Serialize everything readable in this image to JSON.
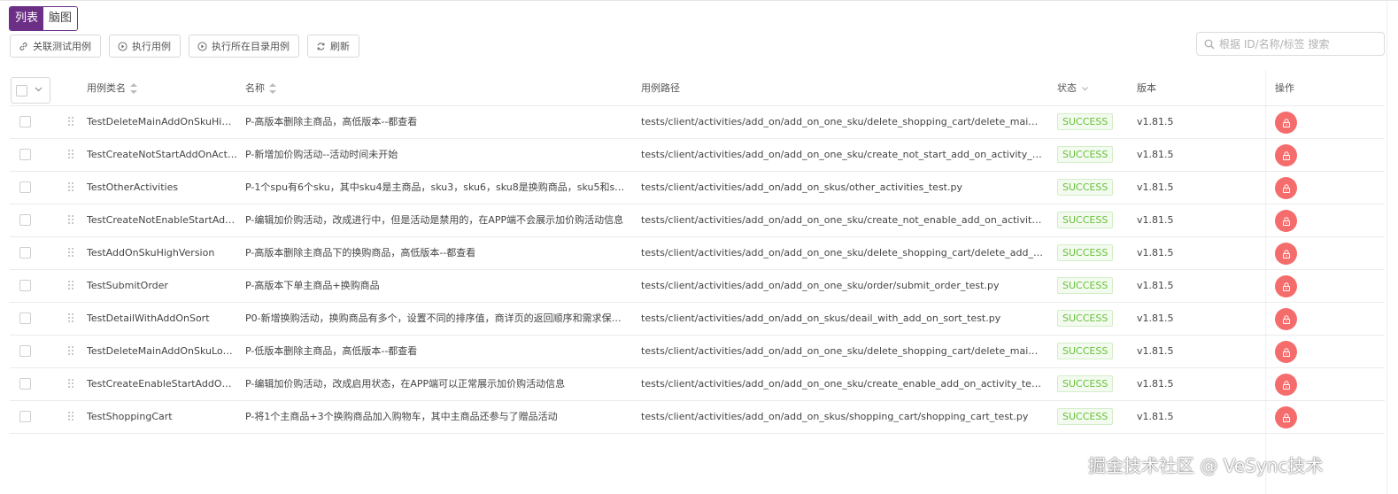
{
  "view_toggle": {
    "list": "列表",
    "mindmap": "脑图"
  },
  "toolbar": {
    "link_cases": "关联测试用例",
    "run_cases": "执行用例",
    "run_dir_cases": "执行所在目录用例",
    "refresh": "刷新"
  },
  "search": {
    "placeholder": "根据 ID/名称/标签 搜索",
    "icon": "search-icon"
  },
  "columns": {
    "class_name": "用例类名",
    "name": "名称",
    "path": "用例路径",
    "status": "状态",
    "version": "版本",
    "actions": "操作"
  },
  "rows": [
    {
      "class_name": "TestDeleteMainAddOnSkuHigh...",
      "name": "P-高版本删除主商品，高低版本--都查看",
      "path": "tests/client/activities/add_on/add_on_one_sku/delete_shopping_cart/delete_main_add_on_s...",
      "status": "SUCCESS",
      "version": "v1.81.5"
    },
    {
      "class_name": "TestCreateNotStartAddOnActivity",
      "name": "P-新增加价购活动--活动时间未开始",
      "path": "tests/client/activities/add_on/add_on_one_sku/create_not_start_add_on_activity_test.py",
      "status": "SUCCESS",
      "version": "v1.81.5"
    },
    {
      "class_name": "TestOtherActivities",
      "name": "P-1个spu有6个sku，其中sku4是主商品，sku3，sku6，sku8是换购商品，sku5和sku7没...",
      "path": "tests/client/activities/add_on/add_on_skus/other_activities_test.py",
      "status": "SUCCESS",
      "version": "v1.81.5"
    },
    {
      "class_name": "TestCreateNotEnableStartAdd...",
      "name": "P-编辑加价购活动，改成进行中，但是活动是禁用的，在APP端不会展示加价购活动信息",
      "path": "tests/client/activities/add_on/add_on_one_sku/create_not_enable_add_on_activity_test.py",
      "status": "SUCCESS",
      "version": "v1.81.5"
    },
    {
      "class_name": "TestAddOnSkuHighVersion",
      "name": "P-高版本删除主商品下的换购商品，高低版本--都查看",
      "path": "tests/client/activities/add_on/add_on_one_sku/delete_shopping_cart/delete_add_on_sku_hig...",
      "status": "SUCCESS",
      "version": "v1.81.5"
    },
    {
      "class_name": "TestSubmitOrder",
      "name": "P-高版本下单主商品+换购商品",
      "path": "tests/client/activities/add_on/add_on_one_sku/order/submit_order_test.py",
      "status": "SUCCESS",
      "version": "v1.81.5"
    },
    {
      "class_name": "TestDetailWithAddOnSort",
      "name": "P0-新增换购活动，换购商品有多个，设置不同的排序值，商详页的返回顺序和需求保持...",
      "path": "tests/client/activities/add_on/add_on_skus/deail_with_add_on_sort_test.py",
      "status": "SUCCESS",
      "version": "v1.81.5"
    },
    {
      "class_name": "TestDeleteMainAddOnSkuLow...",
      "name": "P-低版本删除主商品，高低版本--都查看",
      "path": "tests/client/activities/add_on/add_on_one_sku/delete_shopping_cart/delete_main_add_on_s...",
      "status": "SUCCESS",
      "version": "v1.81.5"
    },
    {
      "class_name": "TestCreateEnableStartAddOnA...",
      "name": "P-编辑加价购活动，改成启用状态，在APP端可以正常展示加价购活动信息",
      "path": "tests/client/activities/add_on/add_on_one_sku/create_enable_add_on_activity_test.py",
      "status": "SUCCESS",
      "version": "v1.81.5"
    },
    {
      "class_name": "TestShoppingCart",
      "name": "P-将1个主商品+3个换购商品加入购物车，其中主商品还参与了赠品活动",
      "path": "tests/client/activities/add_on/add_on_skus/shopping_cart/shopping_cart_test.py",
      "status": "SUCCESS",
      "version": "v1.81.5"
    }
  ],
  "watermark": "掘金技术社区 @ VeSync技术",
  "colors": {
    "accent": "#6b2f85",
    "success": "#67c23a",
    "danger": "#f56c6c"
  }
}
